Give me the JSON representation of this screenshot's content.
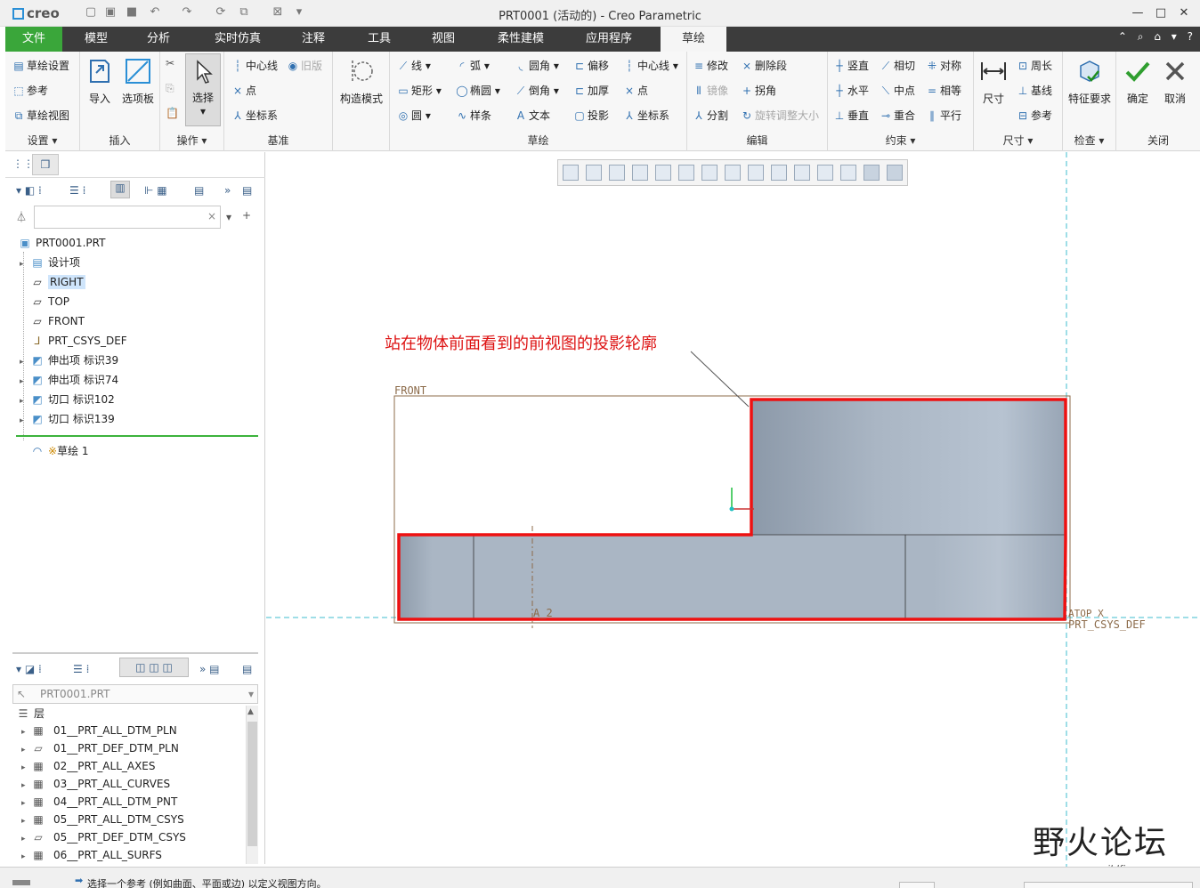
{
  "window": {
    "title": "PRT0001 (活动的) - Creo Parametric",
    "logo": "creo"
  },
  "tabs": [
    "文件",
    "模型",
    "分析",
    "实时仿真",
    "注释",
    "工具",
    "视图",
    "柔性建模",
    "应用程序",
    "草绘"
  ],
  "ribbon": {
    "setup": {
      "label": "设置",
      "items": [
        "草绘设置",
        "参考",
        "草绘视图"
      ]
    },
    "insert": {
      "label": "插入",
      "items": [
        "导入",
        "选项板"
      ]
    },
    "operations": {
      "label": "操作",
      "select": "选择"
    },
    "datum": {
      "label": "基准",
      "items": [
        "中心线",
        "旧版",
        "点",
        "坐标系"
      ]
    },
    "construction": {
      "label": "构造模式"
    },
    "sketch": {
      "label": "草绘",
      "items": [
        "线",
        "弧",
        "圆角",
        "偏移",
        "中心线",
        "矩形",
        "椭圆",
        "倒角",
        "加厚",
        "点",
        "圆",
        "样条",
        "文本",
        "投影",
        "坐标系"
      ]
    },
    "edit": {
      "label": "编辑",
      "items": [
        "修改",
        "删除段",
        "镜像",
        "拐角",
        "分割",
        "旋转调整大小"
      ]
    },
    "constrain": {
      "label": "约束",
      "items": [
        "竖直",
        "相切",
        "对称",
        "水平",
        "中点",
        "相等",
        "垂直",
        "重合",
        "平行"
      ]
    },
    "dimension": {
      "label": "尺寸",
      "items": [
        "尺寸",
        "周长",
        "基线",
        "参考"
      ]
    },
    "inspect": {
      "label": "检查",
      "items": [
        "特征要求"
      ]
    },
    "close": {
      "label": "关闭",
      "items": [
        "确定",
        "取消"
      ]
    }
  },
  "model_tree": {
    "root": "PRT0001.PRT",
    "items": [
      "设计项",
      "RIGHT",
      "TOP",
      "FRONT",
      "PRT_CSYS_DEF",
      "伸出项 标识39",
      "伸出项 标识74",
      "切口 标识102",
      "切口 标识139"
    ],
    "sketch_item": "草绘 1",
    "sketch_mark": "※"
  },
  "layer_tree": {
    "model": "PRT0001.PRT",
    "header": "层",
    "items": [
      "01__PRT_ALL_DTM_PLN",
      "01__PRT_DEF_DTM_PLN",
      "02__PRT_ALL_AXES",
      "03__PRT_ALL_CURVES",
      "04__PRT_ALL_DTM_PNT",
      "05__PRT_ALL_DTM_CSYS",
      "05__PRT_DEF_DTM_CSYS",
      "06__PRT_ALL_SURFS"
    ]
  },
  "canvas": {
    "annotation": "站在物体前面看到的前视图的投影轮廓",
    "plane_label": "FRONT",
    "axis_label": "A_2",
    "csys_label": "PRT_CSYS_DEF",
    "csys_axes": "ATOP X",
    "colors": {
      "profile": "#ee1111",
      "solid": "#a8b4c3",
      "plane": "#8c6b4a",
      "axis": "#3fbccf"
    }
  },
  "status": {
    "message": "选择一个参考 (例如曲面、平面或边) 以定义视图方向。"
  },
  "watermark": {
    "brand": "野火论坛",
    "url": "www.proewildfire.cn"
  }
}
